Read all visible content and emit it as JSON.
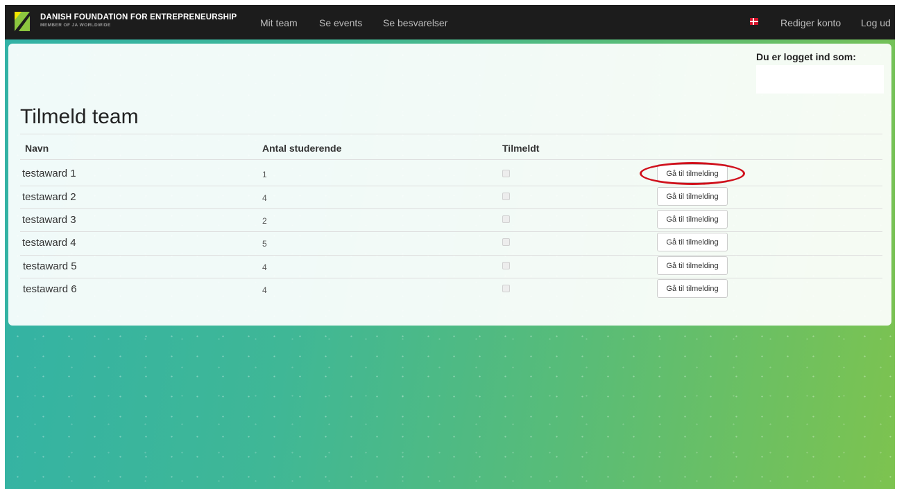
{
  "brand": {
    "title": "DANISH FOUNDATION FOR ENTREPRENEURSHIP",
    "subtitle": "MEMBER OF JA WORLDWIDE"
  },
  "nav": {
    "links": [
      "Mit team",
      "Se events",
      "Se besvarelser"
    ],
    "language_flag": "danish-flag-icon",
    "edit_account": "Rediger konto",
    "logout": "Log ud"
  },
  "user": {
    "label": "Du er logget ind som:",
    "name": ""
  },
  "page": {
    "title": "Tilmeld team",
    "columns": [
      "Navn",
      "Antal studerende",
      "Tilmeldt"
    ],
    "rows": [
      {
        "name": "testaward 1",
        "students": "1",
        "registered": false,
        "action": "Gå til tilmelding"
      },
      {
        "name": "testaward 2",
        "students": "4",
        "registered": false,
        "action": "Gå til tilmelding"
      },
      {
        "name": "testaward 3",
        "students": "2",
        "registered": false,
        "action": "Gå til tilmelding"
      },
      {
        "name": "testaward 4",
        "students": "5",
        "registered": false,
        "action": "Gå til tilmelding"
      },
      {
        "name": "testaward 5",
        "students": "4",
        "registered": false,
        "action": "Gå til tilmelding"
      },
      {
        "name": "testaward 6",
        "students": "4",
        "registered": false,
        "action": "Gå til tilmelding"
      }
    ]
  },
  "colors": {
    "navbar": "#1c1c1c",
    "highlight_ring": "#d0101b",
    "background_start": "#32b2a6",
    "background_end": "#7dc34f"
  }
}
